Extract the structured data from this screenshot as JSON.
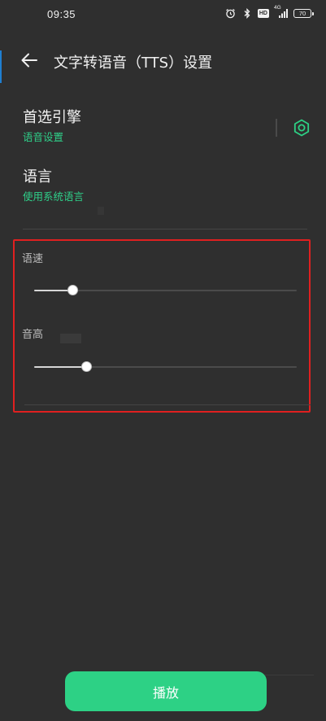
{
  "status_bar": {
    "time": "09:35",
    "network_label": "HD",
    "signal_label": "4G",
    "battery": "70"
  },
  "header": {
    "title": "文字转语音（TTS）设置"
  },
  "preferred_engine": {
    "title": "首选引擎",
    "summary": "语音设置"
  },
  "language": {
    "title": "语言",
    "summary": "使用系统语言"
  },
  "speech_rate": {
    "label": "语速",
    "value": 0.15
  },
  "pitch": {
    "label": "音高",
    "value": 0.2
  },
  "play_button": {
    "label": "播放"
  },
  "colors": {
    "accent": "#2dd185",
    "background": "#2f2f2f",
    "highlight_border": "#e02020"
  }
}
